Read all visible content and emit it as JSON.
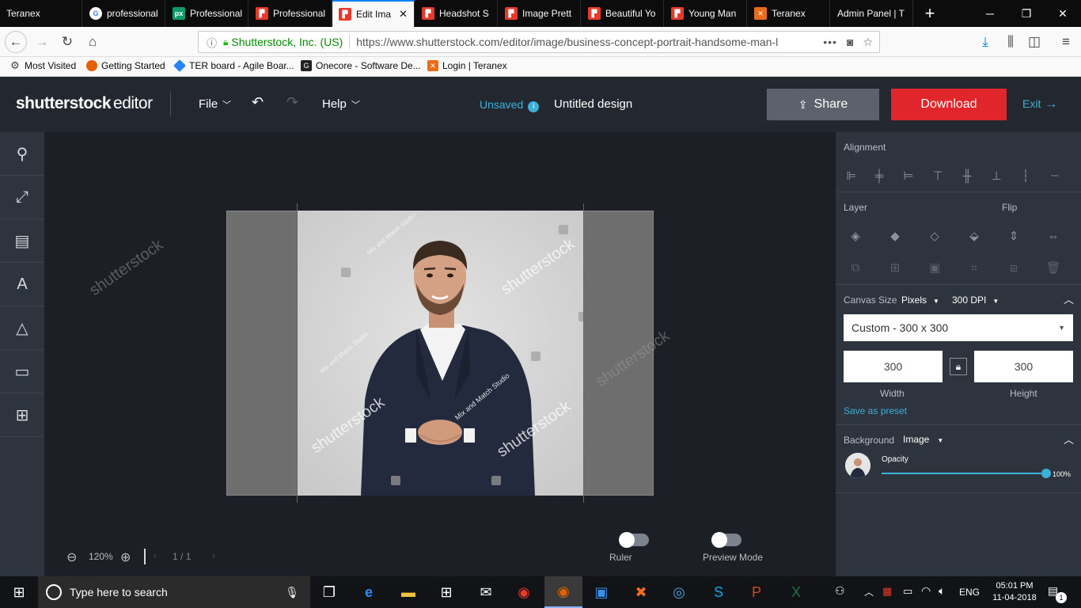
{
  "browser": {
    "tabs": [
      {
        "label": "Teranex",
        "icon": "none"
      },
      {
        "label": "professional",
        "icon": "google-icon"
      },
      {
        "label": "Professional",
        "icon": "pexels-icon"
      },
      {
        "label": "Professional",
        "icon": "shutterstock-icon"
      },
      {
        "label": "Edit Ima",
        "icon": "shutterstock-icon",
        "active": true
      },
      {
        "label": "Headshot S",
        "icon": "shutterstock-icon"
      },
      {
        "label": "Image Prett",
        "icon": "shutterstock-icon"
      },
      {
        "label": "Beautiful Yo",
        "icon": "shutterstock-icon"
      },
      {
        "label": "Young Man",
        "icon": "shutterstock-icon"
      },
      {
        "label": "Teranex",
        "icon": "xampp-icon"
      },
      {
        "label": "Admin Panel | T",
        "icon": "none"
      }
    ],
    "site_identity": "Shutterstock, Inc. (US)",
    "url": "https://www.shutterstock.com/editor/image/business-concept-portrait-handsome-man-l",
    "bookmarks": [
      {
        "label": "Most Visited",
        "icon": "gear-icon"
      },
      {
        "label": "Getting Started",
        "icon": "firefox-icon"
      },
      {
        "label": "TER board - Agile Boar...",
        "icon": "jira-icon"
      },
      {
        "label": "Onecore - Software De...",
        "icon": "g-icon"
      },
      {
        "label": "Login | Teranex",
        "icon": "xampp-icon"
      }
    ]
  },
  "editor": {
    "brand": "shutterstock",
    "brand_suffix": "editor",
    "menu_file": "File",
    "menu_help": "Help",
    "status": "Unsaved",
    "design_name": "Untitled design",
    "share_label": "Share",
    "download_label": "Download",
    "exit_label": "Exit",
    "zoom": "120%",
    "page_current": "1",
    "page_total": "1",
    "page_sep": "/",
    "ruler_label": "Ruler",
    "preview_label": "Preview Mode",
    "watermark": "shutterstock",
    "watermark_credit": "Mix and Match Studio"
  },
  "panel": {
    "alignment_title": "Alignment",
    "layer_title": "Layer",
    "flip_title": "Flip",
    "canvas_size_label": "Canvas Size",
    "units": "Pixels",
    "dpi_value": "300",
    "dpi_label": "DPI",
    "preset": "Custom - 300 x 300",
    "width_value": "300",
    "height_value": "300",
    "width_label": "Width",
    "height_label": "Height",
    "save_preset": "Save as preset",
    "background_label": "Background",
    "background_type": "Image",
    "opacity_label": "Opacity",
    "opacity_value": "100%"
  },
  "taskbar": {
    "search_placeholder": "Type here to search",
    "language": "ENG",
    "time": "05:01 PM",
    "date": "11-04-2018",
    "notification_count": "1"
  },
  "colors": {
    "accent": "#3db0d8",
    "download": "#e0262b",
    "header_bg": "#232830",
    "panel_bg": "#2e343d"
  }
}
